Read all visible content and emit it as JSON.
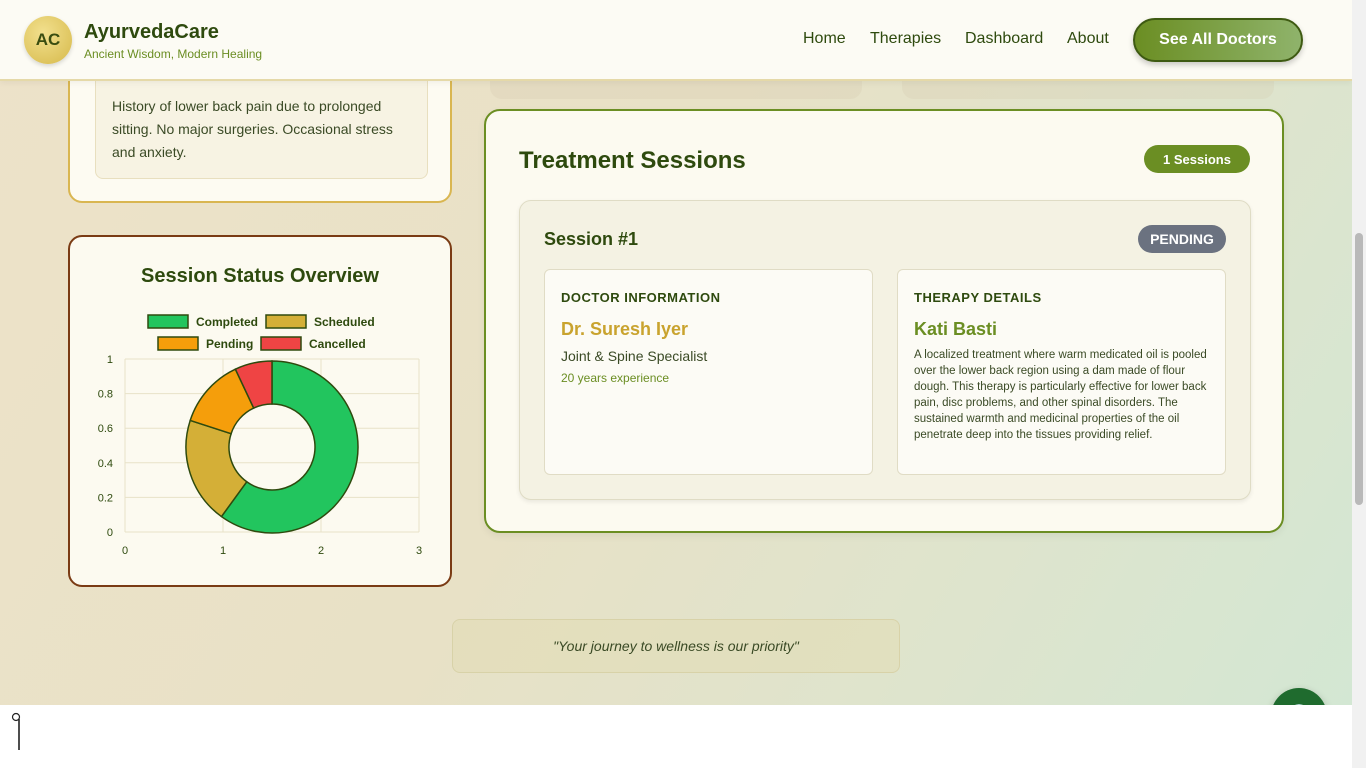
{
  "header": {
    "logo_initials": "AC",
    "brand_name": "AyurvedaCare",
    "tagline": "Ancient Wisdom, Modern Healing",
    "nav": [
      "Home",
      "Therapies",
      "Dashboard",
      "About"
    ],
    "cta_label": "See All Doctors"
  },
  "history": {
    "text": "History of lower back pain due to prolonged sitting. No major surgeries. Occasional stress and anxiety."
  },
  "chart_card": {
    "title": "Session Status Overview"
  },
  "chart_data": {
    "type": "pie",
    "variant": "doughnut",
    "title": "Session Status Overview",
    "legend": [
      "Completed",
      "Scheduled",
      "Pending",
      "Cancelled"
    ],
    "values": [
      0.6,
      0.2,
      0.13,
      0.07
    ],
    "colors": [
      "#22c55e",
      "#d4af37",
      "#f59e0b",
      "#ef4444"
    ],
    "x_ticks": [
      "0",
      "1",
      "2",
      "3"
    ],
    "y_ticks": [
      "0",
      "0.2",
      "0.4",
      "0.6",
      "0.8",
      "1"
    ],
    "xlim": [
      0,
      3
    ],
    "ylim": [
      0,
      1
    ],
    "grid": true,
    "legend_position": "top"
  },
  "treatment": {
    "title": "Treatment Sessions",
    "count_label": "1 Sessions",
    "session": {
      "title": "Session #1",
      "status": "PENDING",
      "doctor_heading": "DOCTOR INFORMATION",
      "doctor_name": "Dr. Suresh Iyer",
      "doctor_specialty": "Joint & Spine Specialist",
      "doctor_experience": "20 years experience",
      "therapy_heading": "THERAPY DETAILS",
      "therapy_name": "Kati Basti",
      "therapy_description": "A localized treatment where warm medicated oil is pooled over the lower back region using a dam made of flour dough. This therapy is particularly effective for lower back pain, disc problems, and other spinal disorders. The sustained warmth and medicinal properties of the oil penetrate deep into the tissues providing relief."
    }
  },
  "quote": "\"Your journey to wellness is our priority\"",
  "icons": {
    "globe": "globe-icon",
    "caret": "text-cursor-icon"
  },
  "colors": {
    "primary": "#6b8e23",
    "gold": "#d4af37",
    "dark_green": "#2e4a0e",
    "pending": "#6b7280"
  }
}
